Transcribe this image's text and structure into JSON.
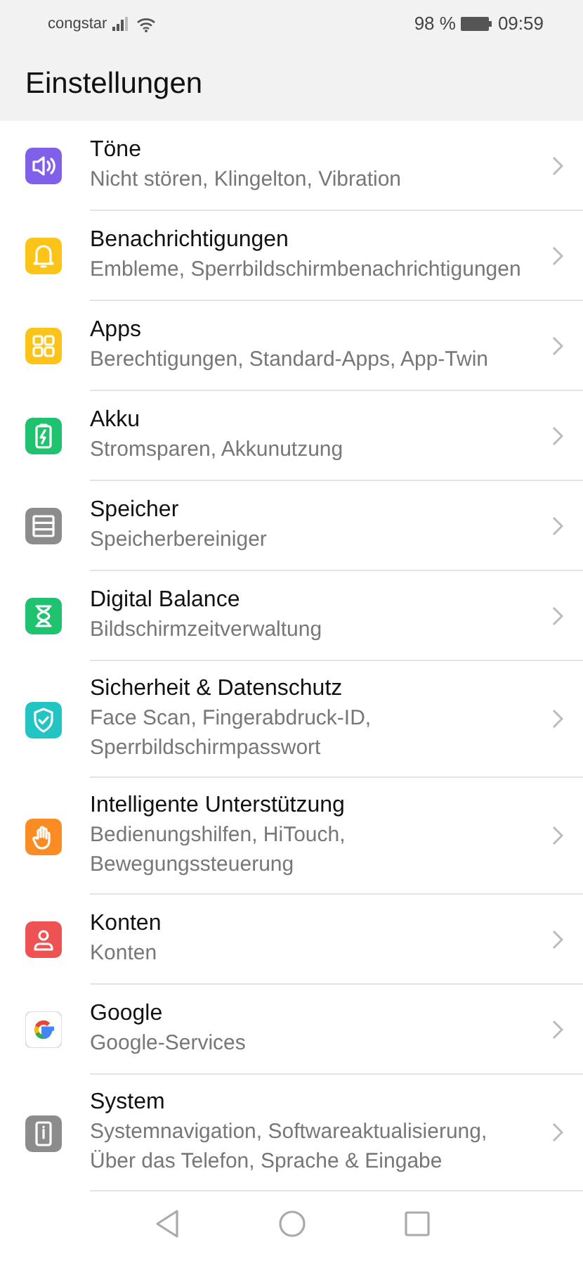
{
  "status_bar": {
    "carrier": "congstar",
    "battery": "98 %",
    "time": "09:59"
  },
  "title": "Einstellungen",
  "items": [
    {
      "title": "Töne",
      "subtitle": "Nicht stören, Klingelton, Vibration",
      "kind": "sound",
      "color": "#8060e8"
    },
    {
      "title": "Benachrichtigungen",
      "subtitle": "Embleme, Sperrbildschirmbenachrichtigungen",
      "kind": "bell",
      "color": "#fcc419"
    },
    {
      "title": "Apps",
      "subtitle": "Berechtigungen, Standard-Apps, App-Twin",
      "kind": "apps",
      "color": "#fcc419"
    },
    {
      "title": "Akku",
      "subtitle": "Stromsparen, Akkunutzung",
      "kind": "battery",
      "color": "#1fc26e"
    },
    {
      "title": "Speicher",
      "subtitle": "Speicherbereiniger",
      "kind": "storage",
      "color": "#8c8c8c"
    },
    {
      "title": "Digital Balance",
      "subtitle": "Bildschirmzeitverwaltung",
      "kind": "hourglass",
      "color": "#1fc26e"
    },
    {
      "title": "Sicherheit & Datenschutz",
      "subtitle": "Face Scan, Fingerabdruck-ID, Sperrbildschirmpasswort",
      "kind": "shield",
      "color": "#22c4c4"
    },
    {
      "title": "Intelligente Unterstützung",
      "subtitle": "Bedienungshilfen, HiTouch, Bewegungssteuerung",
      "kind": "hand",
      "color": "#fb8c24"
    },
    {
      "title": "Konten",
      "subtitle": "Konten",
      "kind": "person",
      "color": "#ee5253"
    },
    {
      "title": "Google",
      "subtitle": "Google-Services",
      "kind": "google"
    },
    {
      "title": "System",
      "subtitle": "Systemnavigation, Softwareaktualisierung, Über das Telefon, Sprache & Eingabe",
      "kind": "phone",
      "color": "#8c8c8c"
    }
  ]
}
